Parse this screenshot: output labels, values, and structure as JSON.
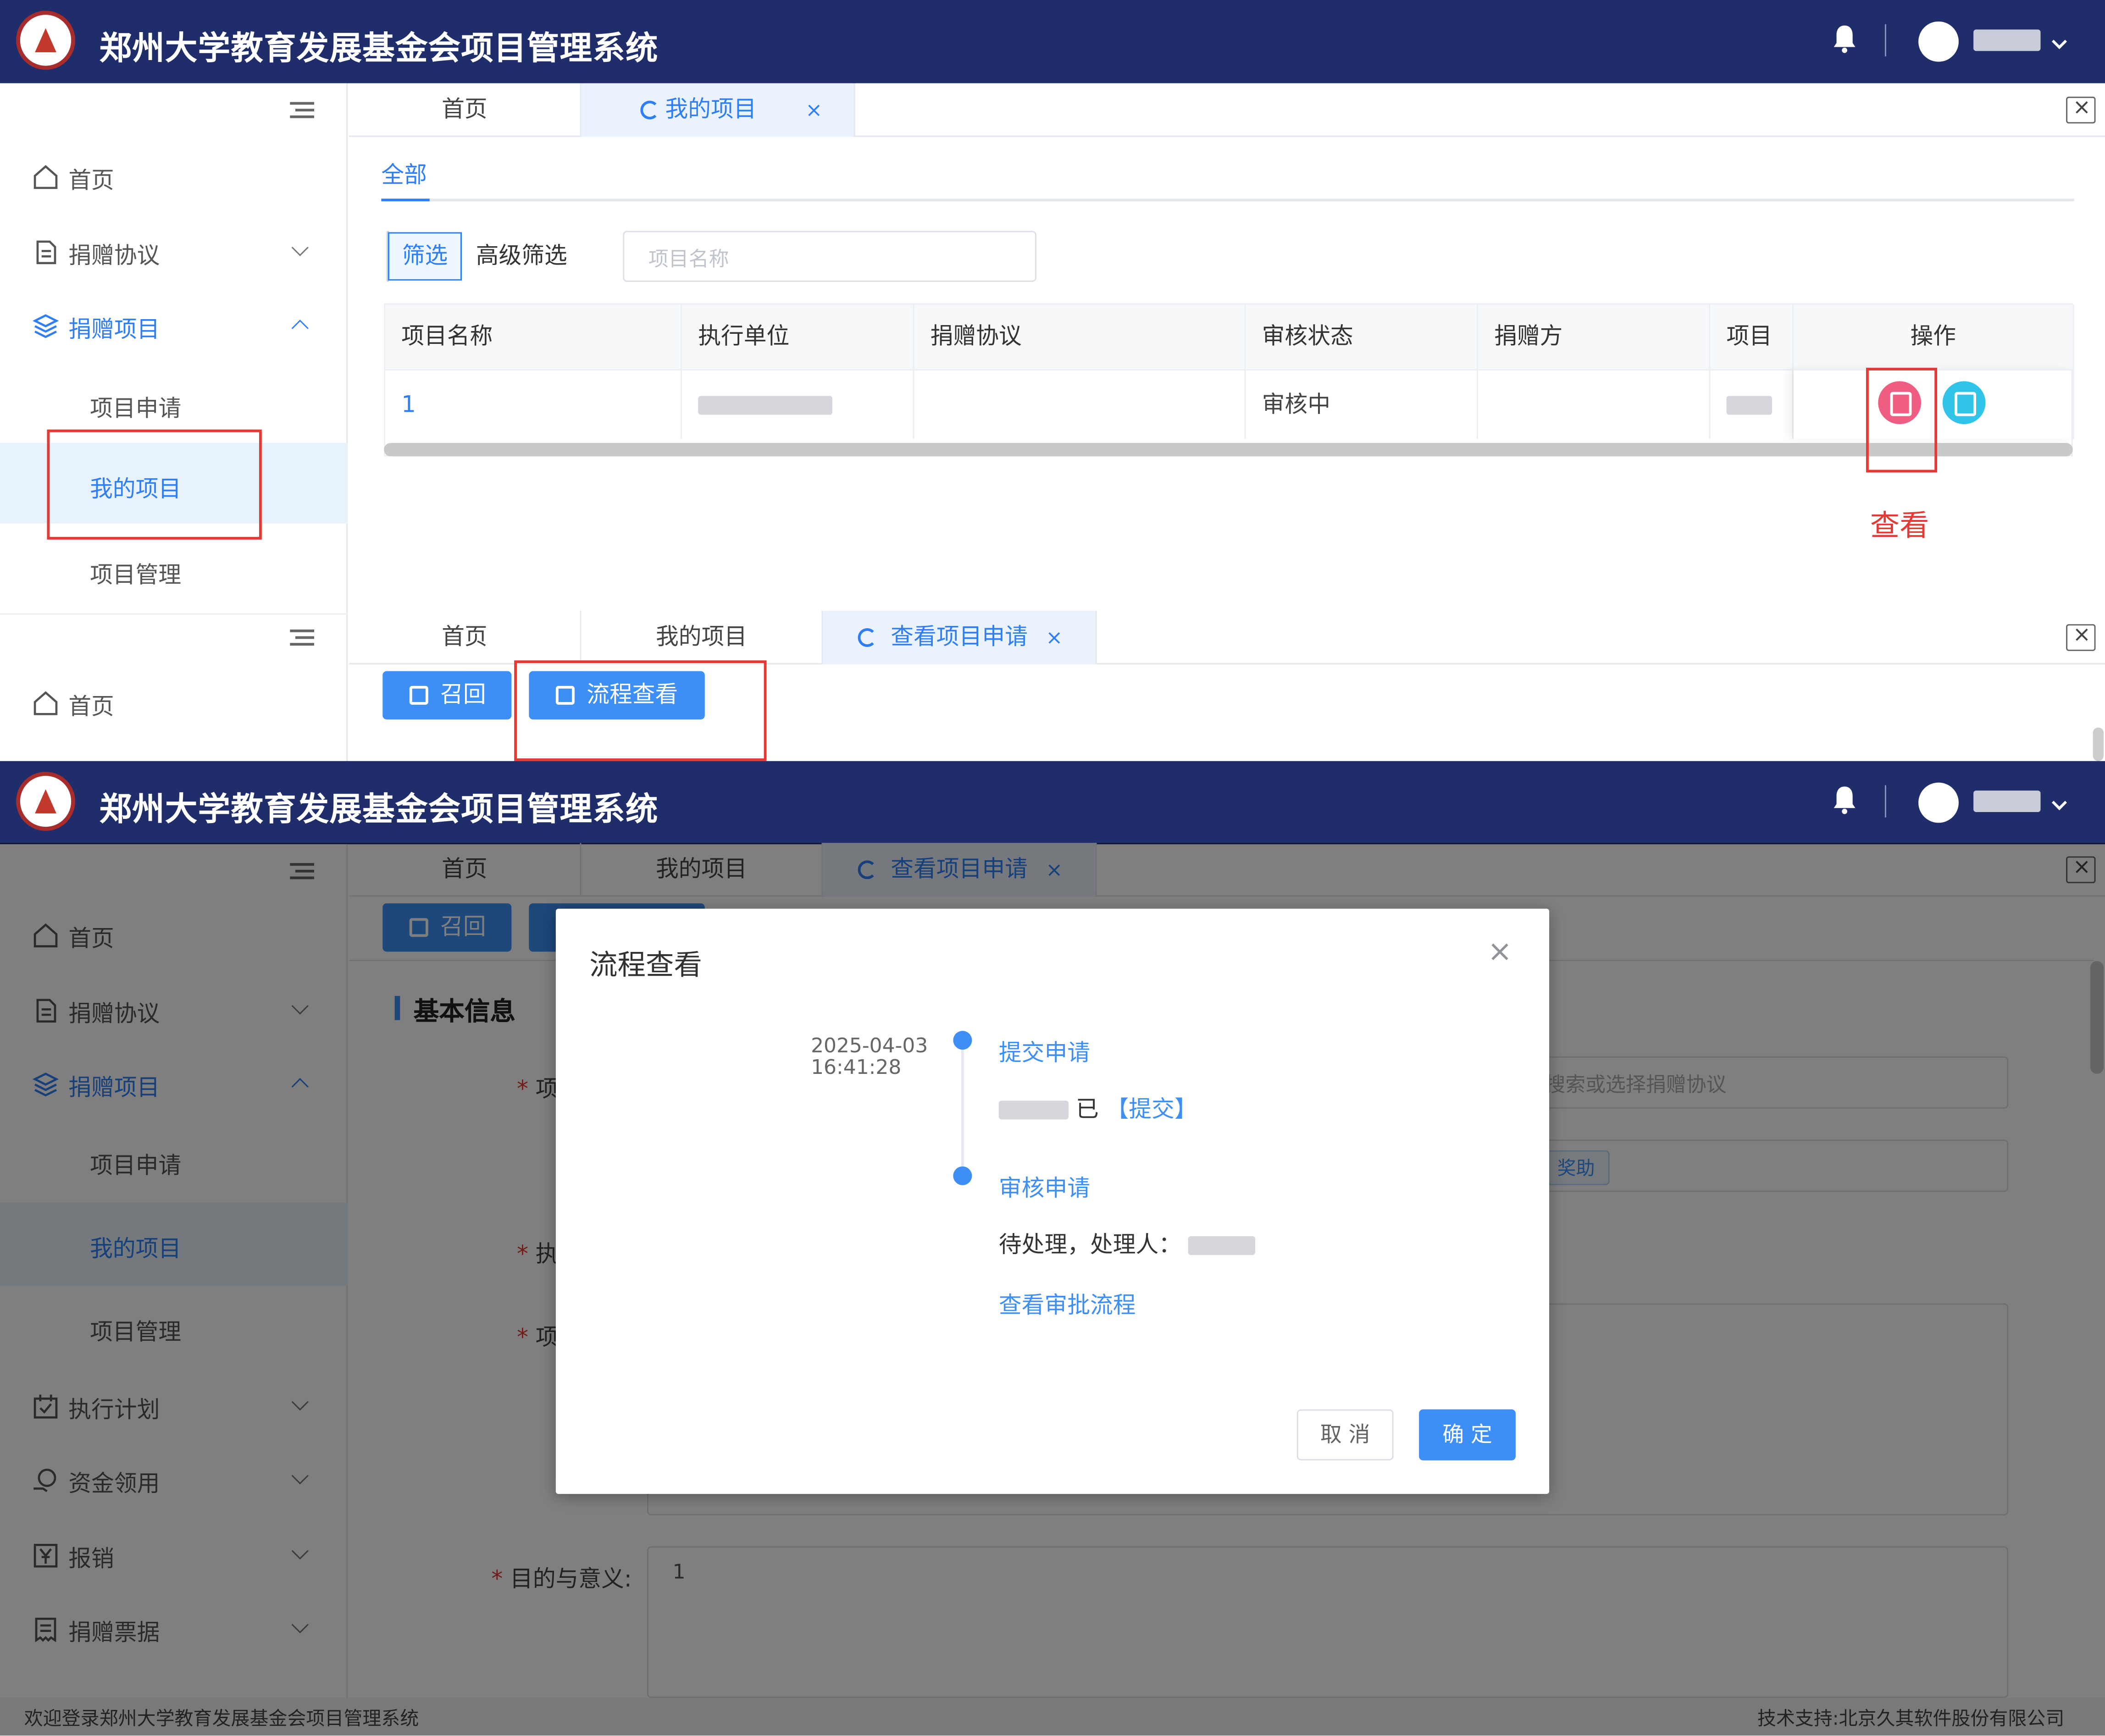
{
  "app": {
    "title": "郑州大学教育发展基金会项目管理系统"
  },
  "menu": {
    "home": "首页",
    "agreement": "捐赠协议",
    "project": "捐赠项目",
    "project_apply": "项目申请",
    "my_project": "我的项目",
    "project_manage": "项目管理",
    "exec_plan": "执行计划",
    "fund_use": "资金领用",
    "reimburse": "报销",
    "receipt": "捐赠票据"
  },
  "top_tabs": {
    "home": "首页",
    "my_project": "我的项目",
    "view_apply": "查看项目申请",
    "close": "×"
  },
  "list": {
    "subtab_all": "全部",
    "filter": "筛选",
    "adv_filter": "高级筛选",
    "search_placeholder": "项目名称",
    "columns": [
      "项目名称",
      "执行单位",
      "捐赠协议",
      "审核状态",
      "捐赠方",
      "项目负",
      "操作"
    ],
    "row": {
      "name": "1",
      "status": "审核中"
    },
    "annotation": "查看"
  },
  "detail": {
    "recall": "召回",
    "flow_view": "流程查看",
    "section": "基本信息",
    "field_project": "项",
    "field_exec": "执",
    "field_item": "项",
    "agreement_placeholder": "搜索或选择捐赠协议",
    "tag": "奖助",
    "purpose_label": "目的与意义:",
    "purpose_value": "1"
  },
  "modal": {
    "title": "流程查看",
    "close": "×",
    "time": "2025-04-03",
    "time2": "16:41:28",
    "step1": "提交申请",
    "step1_status": "已",
    "step1_action": "【提交】",
    "step2": "审核申请",
    "step2_status": "待处理，处理人：",
    "view_flow": "查看审批流程",
    "cancel": "取 消",
    "ok": "确 定"
  },
  "footer": {
    "left": "欢迎登录郑州大学教育发展基金会项目管理系统",
    "right": "技术支持:北京久其软件股份有限公司"
  },
  "colors": {
    "header": "#1f2d6b",
    "primary": "#3d8ff5",
    "highlight": "#e53935"
  }
}
